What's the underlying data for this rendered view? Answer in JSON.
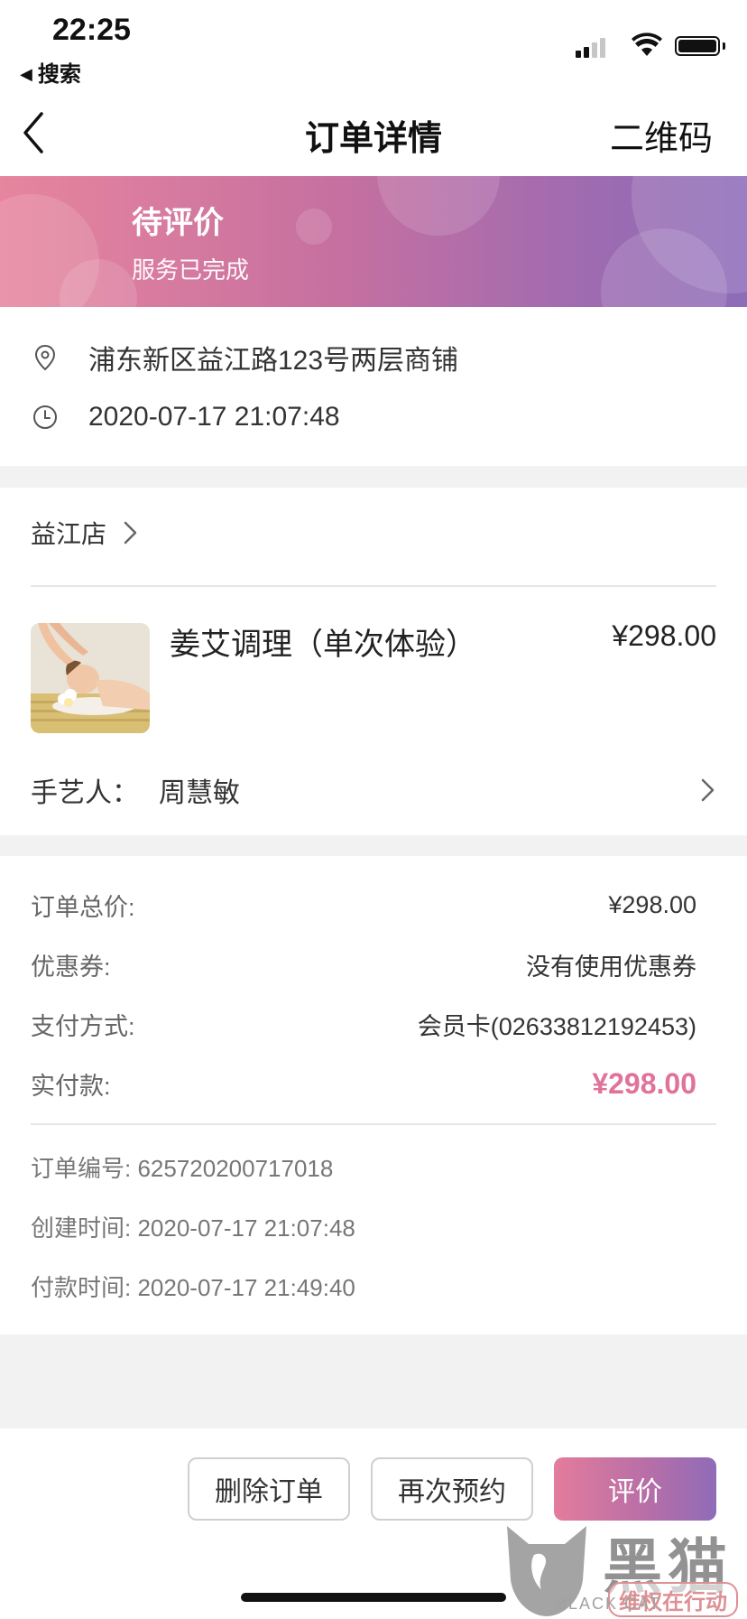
{
  "status_bar": {
    "time": "22:25",
    "back_app": "搜索"
  },
  "nav": {
    "title": "订单详情",
    "qr_label": "二维码"
  },
  "banner": {
    "status": "待评价",
    "substatus": "服务已完成",
    "gradient_start": "#e7859e",
    "gradient_end": "#8d6cb9"
  },
  "location": {
    "address": "浦东新区益江路123号两层商铺",
    "datetime": "2020-07-17 21:07:48"
  },
  "shop": {
    "name": "益江店"
  },
  "service": {
    "name": "姜艾调理（单次体验）",
    "price": "¥298.00"
  },
  "technician": {
    "label": "手艺人：",
    "name": "周慧敏"
  },
  "payment": {
    "total_label": "订单总价:",
    "total_value": "¥298.00",
    "coupon_label": "优惠券:",
    "coupon_value": "没有使用优惠券",
    "method_label": "支付方式:",
    "method_value": "会员卡(02633812192453)",
    "paid_label": "实付款:",
    "paid_value": "¥298.00",
    "accent_color": "#e0739b"
  },
  "order_meta": {
    "order_no": "订单编号: 625720200717018",
    "created": "创建时间: 2020-07-17 21:07:48",
    "paid_at": "付款时间: 2020-07-17 21:49:40"
  },
  "actions": {
    "delete": "删除订单",
    "rebook": "再次预约",
    "review": "评价"
  },
  "watermark": {
    "big": "黑猫",
    "small": "维权在行动",
    "en": "BLACK CAT"
  }
}
